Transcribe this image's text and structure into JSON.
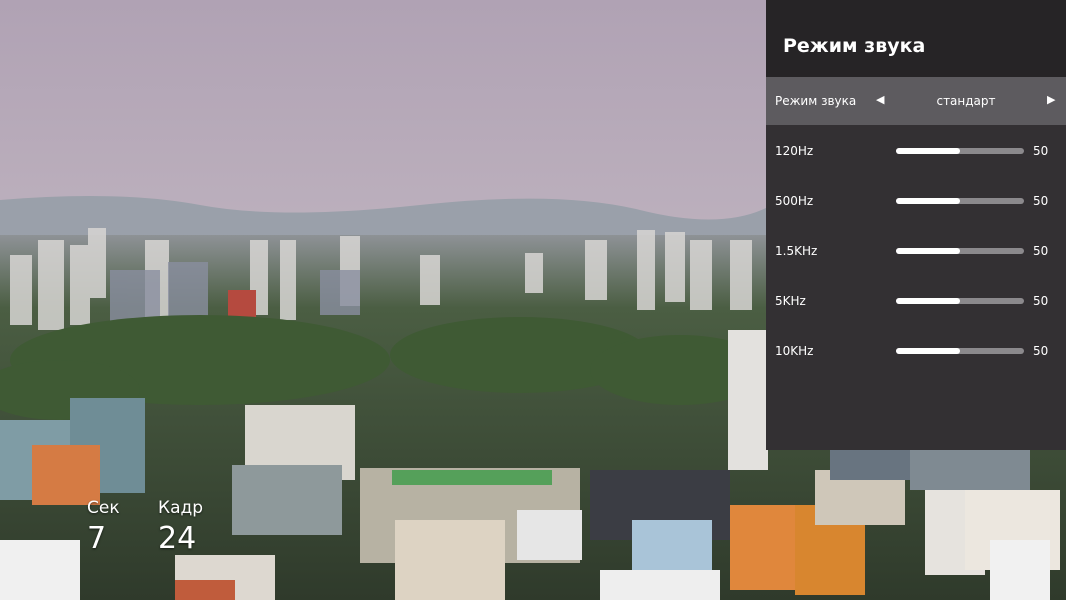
{
  "colors": {
    "panel_bg": "#333033",
    "panel_header_bg": "#262426",
    "mode_row_bg": "#5d5b5f",
    "slider_fill": "#ffffff",
    "slider_track": "#8b898c"
  },
  "overlay": {
    "sec_label": "Сек",
    "sec_value": "7",
    "frame_label": "Кадр",
    "frame_value": "24"
  },
  "sound_panel": {
    "title": "Режим звука",
    "mode": {
      "label": "Режим звука",
      "value": "стандарт",
      "left_icon": "triangle-left-icon",
      "right_icon": "triangle-right-icon"
    },
    "bands": [
      {
        "label": "120Hz",
        "value": 50,
        "level": 0.5
      },
      {
        "label": "500Hz",
        "value": 50,
        "level": 0.5
      },
      {
        "label": "1.5KHz",
        "value": 50,
        "level": 0.5
      },
      {
        "label": "5KHz",
        "value": 50,
        "level": 0.5
      },
      {
        "label": "10KHz",
        "value": 50,
        "level": 0.5
      }
    ]
  }
}
